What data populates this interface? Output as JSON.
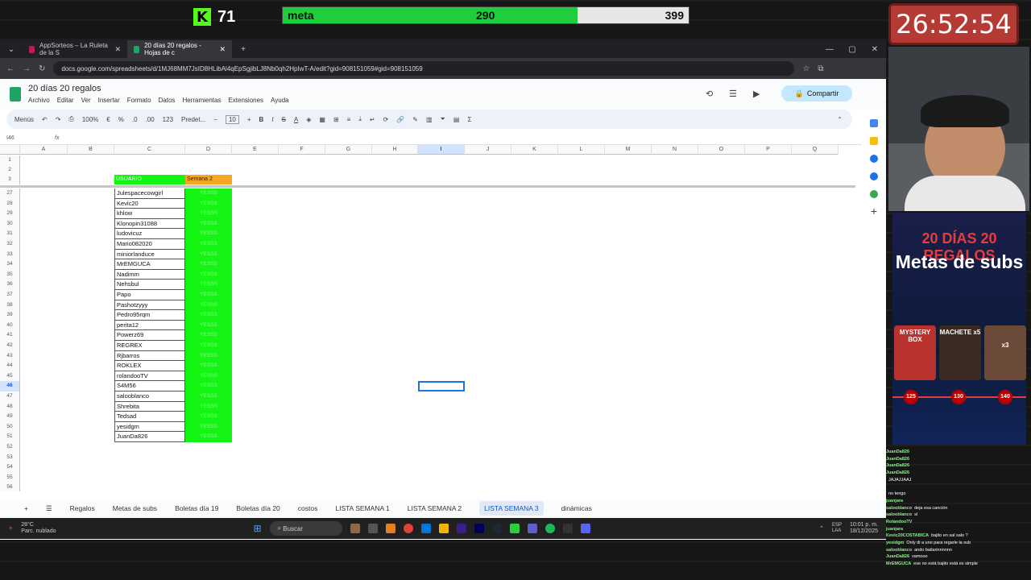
{
  "overlay": {
    "kick_icon": "K",
    "viewers": "71",
    "meta": {
      "label": "meta",
      "current": "290",
      "goal": "399",
      "progress": 0.727
    },
    "timer": "26:52:54"
  },
  "browser": {
    "tabs": [
      {
        "label": "AppSorteos – La Ruleta de la S",
        "color": "#c2185b"
      },
      {
        "label": "20 días 20 regalos - Hojas de c",
        "color": "#1fa463"
      }
    ],
    "url": "docs.google.com/spreadsheets/d/1MJ68MM7JsID8HLibAl4qEpSgjibLJ8Nb0qh2HpIwT-A/edit?gid=908151059#gid=908151059"
  },
  "sheet": {
    "title": "20 días 20 regalos",
    "menu": [
      "Archivo",
      "Editar",
      "Ver",
      "Insertar",
      "Formato",
      "Datos",
      "Herramientas",
      "Extensiones",
      "Ayuda"
    ],
    "share_label": "Compartir",
    "toolbar": {
      "menus": "Menús",
      "zoom": "100%",
      "currency": "€",
      "percent": "%",
      "dec1": ".0",
      "dec2": ".00",
      "num": "123",
      "font": "Predet...",
      "size": "10"
    },
    "cell_ref": "I46",
    "fx": "fx",
    "columns": [
      "A",
      "B",
      "C",
      "D",
      "E",
      "F",
      "G",
      "H",
      "I",
      "J",
      "K",
      "L",
      "M",
      "N",
      "O",
      "P",
      "Q"
    ],
    "header_row": {
      "user": "USUARIO",
      "week": "Semana 2"
    },
    "top_rows": [
      "1",
      "2",
      "3"
    ],
    "rows": [
      {
        "n": "27",
        "user": "Julespacecowgirl",
        "v": "YESSS"
      },
      {
        "n": "28",
        "user": "Kevic20",
        "v": "YESSS"
      },
      {
        "n": "29",
        "user": "khlow",
        "v": "YESSS"
      },
      {
        "n": "30",
        "user": "Klonopin31088",
        "v": "YESSS"
      },
      {
        "n": "31",
        "user": "ludovicuz",
        "v": "YESSS"
      },
      {
        "n": "32",
        "user": "Mario082020",
        "v": "YESSS"
      },
      {
        "n": "33",
        "user": "miniorlanduce",
        "v": "YESSS"
      },
      {
        "n": "34",
        "user": "MrEMGUCA",
        "v": "YESSS"
      },
      {
        "n": "35",
        "user": "Nadimm",
        "v": "YESSS"
      },
      {
        "n": "36",
        "user": "Nehsbul",
        "v": "YESSS"
      },
      {
        "n": "37",
        "user": "Papo",
        "v": "YESSS"
      },
      {
        "n": "38",
        "user": "Pashotzyyy",
        "v": "YESSS"
      },
      {
        "n": "39",
        "user": "Pedro95rqm",
        "v": "YESSS"
      },
      {
        "n": "40",
        "user": "perita12",
        "v": "YESSS"
      },
      {
        "n": "41",
        "user": "Powerz69",
        "v": "YESSS"
      },
      {
        "n": "42",
        "user": "REGREX",
        "v": "YESSS"
      },
      {
        "n": "43",
        "user": "Rjbarros",
        "v": "YESSS"
      },
      {
        "n": "44",
        "user": "ROKLEX",
        "v": "YESSS"
      },
      {
        "n": "45",
        "user": "rolandooTV",
        "v": "YESSS"
      },
      {
        "n": "46",
        "user": "S4M56",
        "v": "YESSS"
      },
      {
        "n": "47",
        "user": "salooblanco",
        "v": "YESSS"
      },
      {
        "n": "48",
        "user": "Shrebita",
        "v": "YESSS"
      },
      {
        "n": "49",
        "user": "Tedsad",
        "v": "YESSS"
      },
      {
        "n": "50",
        "user": "yesidgm",
        "v": "YESSS"
      },
      {
        "n": "51",
        "user": "JuanDa826",
        "v": "YESSS"
      }
    ],
    "empty_rows": [
      "52",
      "53",
      "54",
      "55",
      "56"
    ],
    "tabs": [
      "Regalos",
      "Metas de subs",
      "Boletas día 19",
      "Boletas día 20",
      "costos",
      "LISTA SEMANA 1",
      "LISTA SEMANA 2",
      "LISTA SEMANA 3",
      "dinámicas"
    ],
    "active_tab": "LISTA SEMANA 3"
  },
  "taskbar": {
    "weather_temp": "28°C",
    "weather_desc": "Parc. nublado",
    "search": "Buscar",
    "lang": "ESP\nLAA",
    "time": "10:01 p. m.",
    "date": "18/12/2025"
  },
  "promo": {
    "line1": "20 DÍAS 20 REGALOS",
    "line2": "Metas de subs",
    "prizes": [
      {
        "label": "MYSTERY BOX",
        "level": "125"
      },
      {
        "label": "MACHETE x5",
        "level": "130"
      },
      {
        "label": "x3",
        "level": "140"
      }
    ]
  },
  "chat": [
    {
      "u": "JuanDa826",
      "m": ""
    },
    {
      "u": "JuanDa826",
      "m": ""
    },
    {
      "u": "JuanDa826",
      "m": ""
    },
    {
      "u": "JuanDa826",
      "m": ""
    },
    {
      "u": "",
      "m": "JAJAJJAAJ"
    },
    {
      "u": "",
      "m": ""
    },
    {
      "u": "",
      "m": "no tengo"
    },
    {
      "u": "juanjara",
      "m": ""
    },
    {
      "u": "salooblanco",
      "m": "deja esa canción"
    },
    {
      "u": "salooblanco",
      "m": "sí"
    },
    {
      "u": "RolandooTV",
      "m": ""
    },
    {
      "u": "juanjara",
      "m": ""
    },
    {
      "u": "Kevic20COSTABICA",
      "m": "bajito en sal salo ?"
    },
    {
      "u": "yesidgm",
      "m": "Only di a uno para regarle la sub"
    },
    {
      "u": "salooblanco",
      "m": "ando bailarinnnnnn"
    },
    {
      "u": "JuanDa826",
      "m": "vamooo"
    },
    {
      "u": "MrEMGUCA",
      "m": "ese no está bajito está es simple"
    }
  ]
}
